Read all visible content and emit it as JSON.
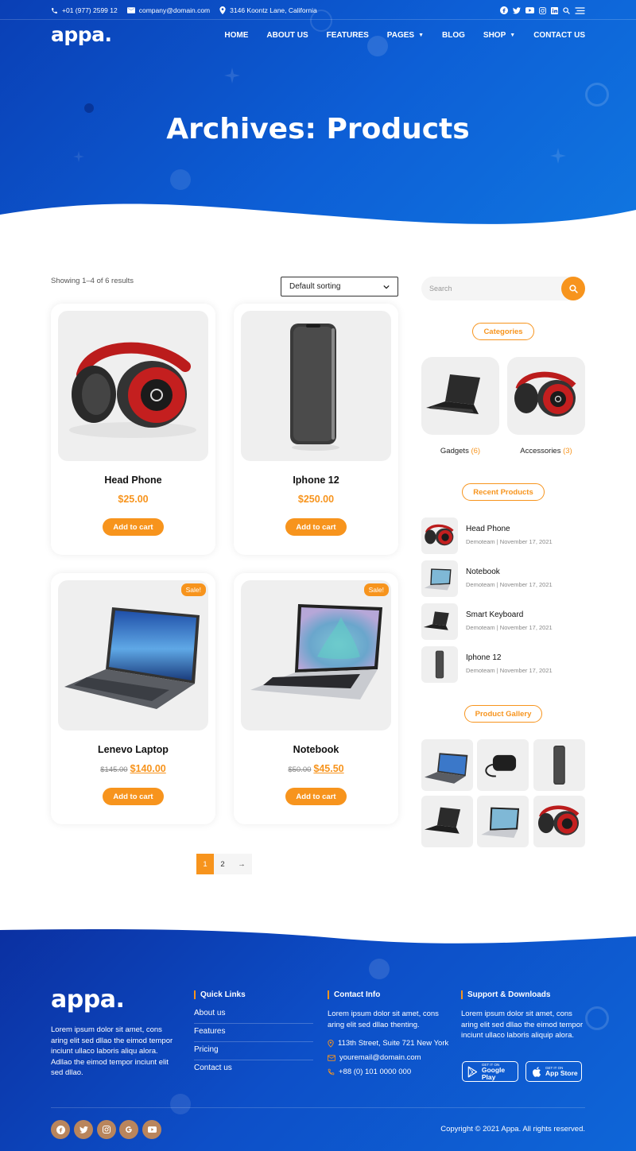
{
  "topbar": {
    "phone": "+01 (977) 2599 12",
    "email": "company@domain.com",
    "address": "3146 Koontz Lane, California"
  },
  "header": {
    "logo": "appa.",
    "nav": [
      "HOME",
      "ABOUT US",
      "FEATURES",
      "PAGES",
      "BLOG",
      "SHOP",
      "CONTACT US"
    ]
  },
  "hero": {
    "title": "Archives: Products"
  },
  "shop": {
    "showing": "Showing 1–4 of 6 results",
    "sorting": "Default sorting",
    "add_to_cart": "Add to cart",
    "sale_badge": "Sale!",
    "products": [
      {
        "name": "Head Phone",
        "price": "$25.00",
        "old_price": ""
      },
      {
        "name": "Iphone 12",
        "price": "$250.00",
        "old_price": ""
      },
      {
        "name": "Lenevo Laptop",
        "price": "$140.00",
        "old_price": "$145.00"
      },
      {
        "name": "Notebook",
        "price": "$45.50",
        "old_price": "$50.00"
      }
    ],
    "pagination": {
      "current": "1",
      "next": "2",
      "arrow": "→"
    }
  },
  "sidebar": {
    "search_placeholder": "Search",
    "categories_title": "Categories",
    "categories": [
      {
        "name": "Gadgets",
        "count": "(6)"
      },
      {
        "name": "Accessories",
        "count": "(3)"
      }
    ],
    "recent_title": "Recent Products",
    "recent": [
      {
        "title": "Head Phone",
        "meta": "Demoteam | November 17, 2021"
      },
      {
        "title": "Notebook",
        "meta": "Demoteam | November 17, 2021"
      },
      {
        "title": "Smart Keyboard",
        "meta": "Demoteam | November 17, 2021"
      },
      {
        "title": "Iphone 12",
        "meta": "Demoteam | November 17, 2021"
      }
    ],
    "gallery_title": "Product Gallery"
  },
  "footer": {
    "logo": "appa.",
    "about": "Lorem ipsum dolor sit amet, cons aring elit sed dllao the eimod tempor inciunt ullaco laboris aliqu alora. Adllao the eimod tempor inciunt elit sed dllao.",
    "quick_title": "Quick Links",
    "quick_links": [
      "About us",
      "Features",
      "Pricing",
      "Contact us"
    ],
    "contact_title": "Contact Info",
    "contact_text": "Lorem ipsum dolor sit amet, cons aring elit sed dllao thenting.",
    "contact_address": "113th Street, Suite 721 New York",
    "contact_email": "youremail@domain.com",
    "contact_phone": "+88 (0) 101 0000 000",
    "support_title": "Support & Downloads",
    "support_text": "Lorem ipsum dolor sit amet, cons aring elit sed dllao the eimod tempor inciunt ullaco laboris aliquip alora.",
    "google_small": "GET IT ON",
    "google_big": "Google Play",
    "apple_small": "GET IT ON",
    "apple_big": "App Store",
    "copyright": "Copyright © 2021 Appa. All rights reserved."
  },
  "colors": {
    "accent": "#f7941d",
    "primary": "#0d5fd6",
    "social": "#b9855c"
  },
  "icons": [
    "phone-icon",
    "mail-icon",
    "map-pin-icon",
    "facebook-icon",
    "twitter-icon",
    "youtube-icon",
    "instagram-icon",
    "linkedin-icon",
    "search-icon",
    "menu-icon",
    "google-icon",
    "play-store-icon",
    "apple-icon"
  ]
}
